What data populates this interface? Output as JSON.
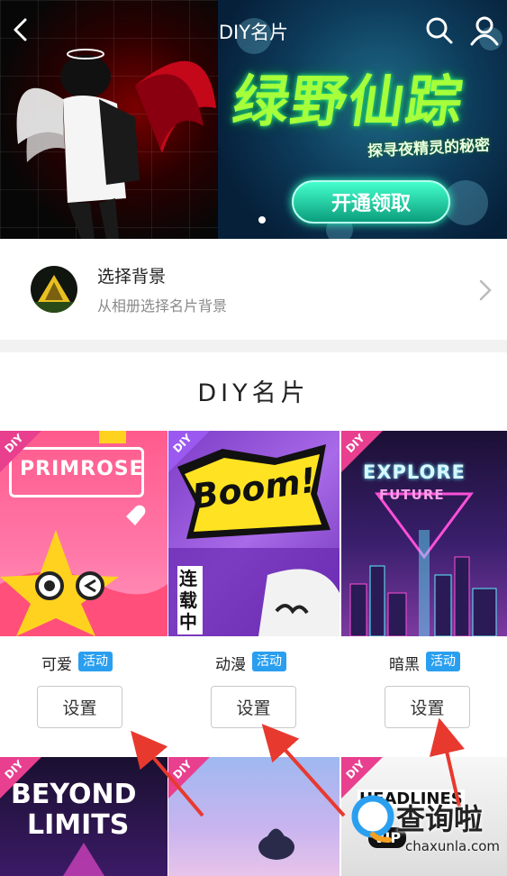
{
  "nav": {
    "title": "DIY名片"
  },
  "banner": {
    "title": "绿野仙踪",
    "subtitle": "探寻夜精灵的秘密",
    "button": "开通领取"
  },
  "background_picker": {
    "title": "选择背景",
    "subtitle": "从相册选择名片背景"
  },
  "section": {
    "title": "DIY名片"
  },
  "cards": [
    {
      "ribbon": "DIY",
      "art_text": "PRIMROSE",
      "name": "可爱",
      "badge": "活动",
      "button": "设置"
    },
    {
      "ribbon": "DIY",
      "art_text": "Boom!",
      "art_text2": "连载中",
      "name": "动漫",
      "badge": "活动",
      "button": "设置"
    },
    {
      "ribbon": "DIY",
      "art_text": "EXPLORE",
      "art_text2": "FUTURE",
      "name": "暗黑",
      "badge": "活动",
      "button": "设置"
    }
  ],
  "bottom_cards": [
    {
      "ribbon": "DIY",
      "art_text": "BEYOND",
      "art_text2": "LIMITS"
    },
    {
      "ribbon": "DIY"
    },
    {
      "ribbon": "DIY",
      "art_text": "HEADLINES",
      "art_text2": "VIP"
    }
  ],
  "watermark": {
    "text": "查询啦",
    "url": "chaxunla.com"
  },
  "colors": {
    "badge": "#2a9ff0",
    "ribbon": "#e83f8f",
    "arrow": "#e8392f"
  }
}
